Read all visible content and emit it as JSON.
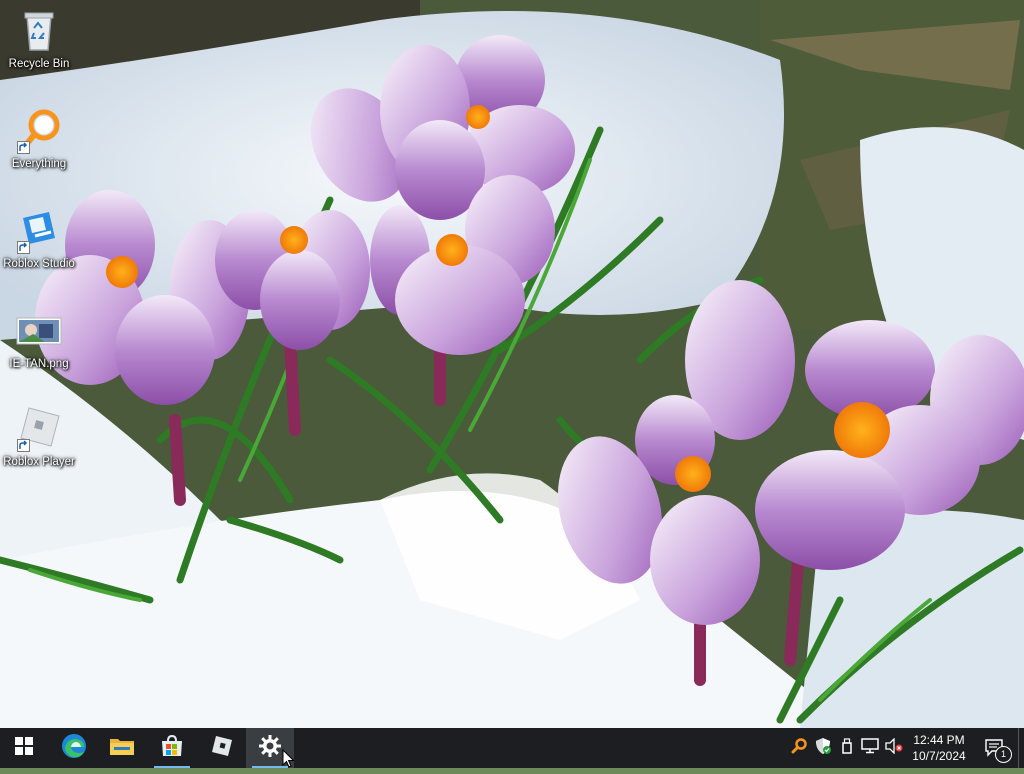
{
  "desktop": {
    "icons": [
      {
        "label": "Recycle Bin",
        "icon": "recycle-bin-icon"
      },
      {
        "label": "Everything",
        "icon": "everything-search-icon",
        "shortcut": true
      },
      {
        "label": "Roblox Studio",
        "icon": "roblox-studio-icon",
        "shortcut": true
      },
      {
        "label": "IE-TAN.png",
        "icon": "image-file-icon"
      },
      {
        "label": "Roblox Player",
        "icon": "roblox-player-icon",
        "shortcut": true
      }
    ],
    "wallpaper": "purple crocus flowers in snow"
  },
  "taskbar": {
    "apps": [
      {
        "icon": "windows-start-icon"
      },
      {
        "icon": "edge-icon"
      },
      {
        "icon": "file-explorer-icon"
      },
      {
        "icon": "microsoft-store-icon",
        "active": true
      },
      {
        "icon": "roblox-icon"
      },
      {
        "icon": "settings-gear-icon",
        "active": true,
        "focused": true
      }
    ],
    "tray": [
      {
        "icon": "everything-tray-icon"
      },
      {
        "icon": "windows-security-icon"
      },
      {
        "icon": "usb-device-icon"
      },
      {
        "icon": "network-icon"
      },
      {
        "icon": "volume-muted-icon"
      }
    ],
    "clock": {
      "time": "12:44 PM",
      "date": "10/7/2024"
    },
    "notifications": {
      "count": "1"
    }
  },
  "colors": {
    "taskbar": "#1c1e22",
    "active_indicator": "#76b9ed",
    "everything_orange": "#f7941d",
    "roblox_blue": "#2b8de4"
  }
}
